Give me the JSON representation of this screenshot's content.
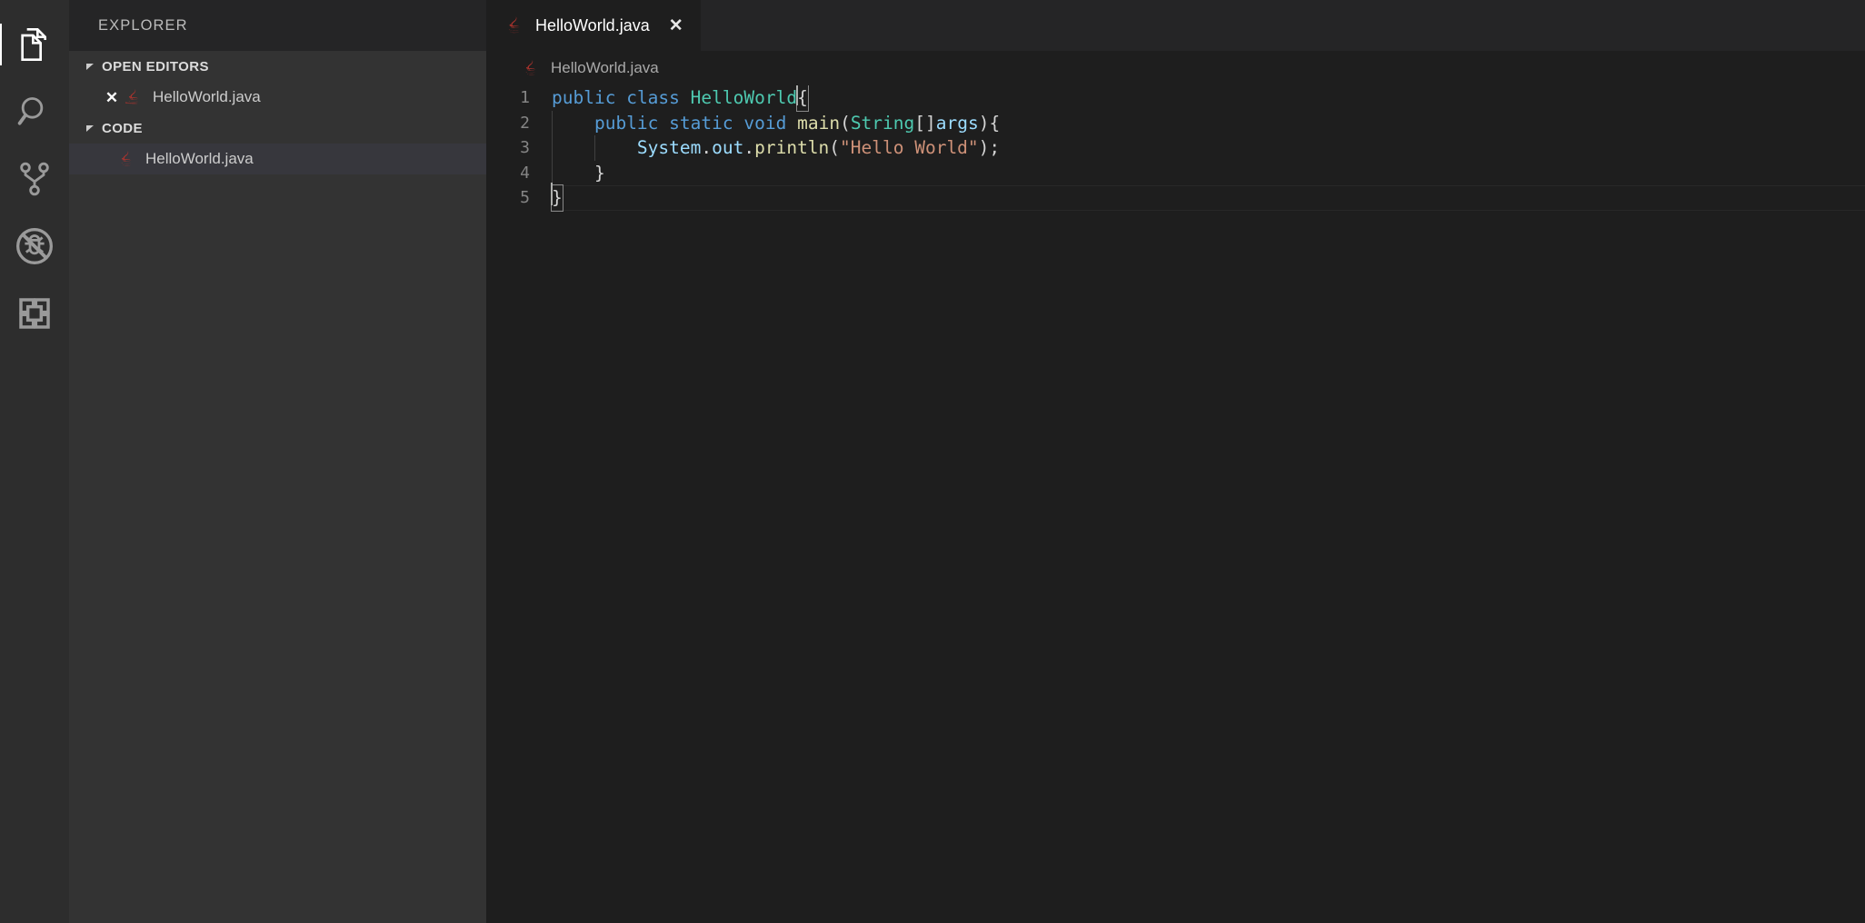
{
  "theme": {
    "editor_bg": "#1e1e1e",
    "sidebar_bg": "#333333",
    "activitybar_bg": "#2d2d2d",
    "tabbar_bg": "#252526",
    "selected_row_bg": "#37373d",
    "keyword": "#569cd6",
    "type": "#4ec9b0",
    "function": "#dcdcaa",
    "variable": "#9cdcfe",
    "string": "#ce9178",
    "line_number": "#858585",
    "java_icon": "#b1342e"
  },
  "activity_bar": {
    "items": [
      {
        "name": "explorer",
        "icon": "files-icon",
        "active": true,
        "title": "Explorer"
      },
      {
        "name": "search",
        "icon": "search-icon",
        "active": false,
        "title": "Search"
      },
      {
        "name": "source-control",
        "icon": "source-control-icon",
        "active": false,
        "title": "Source Control"
      },
      {
        "name": "run-debug",
        "icon": "debug-disabled-icon",
        "active": false,
        "title": "Run and Debug"
      },
      {
        "name": "extensions",
        "icon": "extensions-icon",
        "active": false,
        "title": "Extensions"
      }
    ]
  },
  "sidebar": {
    "title": "EXPLORER",
    "sections": [
      {
        "label": "OPEN EDITORS",
        "expanded": true,
        "items": [
          {
            "label": "HelloWorld.java",
            "icon": "java-file-icon",
            "close": "✕",
            "selected": false
          }
        ]
      },
      {
        "label": "CODE",
        "expanded": true,
        "items": [
          {
            "label": "HelloWorld.java",
            "icon": "java-file-icon",
            "selected": true
          }
        ]
      }
    ]
  },
  "editor": {
    "tabs": [
      {
        "label": "HelloWorld.java",
        "icon": "java-file-icon",
        "active": true,
        "close": "✕"
      }
    ],
    "breadcrumb": {
      "label": "HelloWorld.java",
      "icon": "java-file-icon"
    },
    "language": "java",
    "cursor_line": 5,
    "code_lines": [
      {
        "number": "1",
        "tokens": [
          {
            "text": "public",
            "cls": "kw"
          },
          {
            "text": " ",
            "cls": "pun"
          },
          {
            "text": "class",
            "cls": "kw"
          },
          {
            "text": " ",
            "cls": "pun"
          },
          {
            "text": "HelloWorld",
            "cls": "typ"
          },
          {
            "text": "{",
            "cls": "brk"
          }
        ]
      },
      {
        "number": "2",
        "tokens": [
          {
            "text": "    ",
            "cls": "pun"
          },
          {
            "text": "public",
            "cls": "kw"
          },
          {
            "text": " ",
            "cls": "pun"
          },
          {
            "text": "static",
            "cls": "kw"
          },
          {
            "text": " ",
            "cls": "pun"
          },
          {
            "text": "void",
            "cls": "kw"
          },
          {
            "text": " ",
            "cls": "pun"
          },
          {
            "text": "main",
            "cls": "fn"
          },
          {
            "text": "(",
            "cls": "pun"
          },
          {
            "text": "String",
            "cls": "typ"
          },
          {
            "text": "[]",
            "cls": "pun"
          },
          {
            "text": "args",
            "cls": "var"
          },
          {
            "text": "){",
            "cls": "pun"
          }
        ]
      },
      {
        "number": "3",
        "tokens": [
          {
            "text": "        ",
            "cls": "pun"
          },
          {
            "text": "System",
            "cls": "var"
          },
          {
            "text": ".",
            "cls": "pun"
          },
          {
            "text": "out",
            "cls": "var"
          },
          {
            "text": ".",
            "cls": "pun"
          },
          {
            "text": "println",
            "cls": "fn"
          },
          {
            "text": "(",
            "cls": "pun"
          },
          {
            "text": "\"Hello World\"",
            "cls": "str"
          },
          {
            "text": ");",
            "cls": "pun"
          }
        ]
      },
      {
        "number": "4",
        "tokens": [
          {
            "text": "    ",
            "cls": "pun"
          },
          {
            "text": "}",
            "cls": "pun"
          }
        ]
      },
      {
        "number": "5",
        "tokens": [
          {
            "text": "}",
            "cls": "brk"
          }
        ]
      }
    ]
  }
}
